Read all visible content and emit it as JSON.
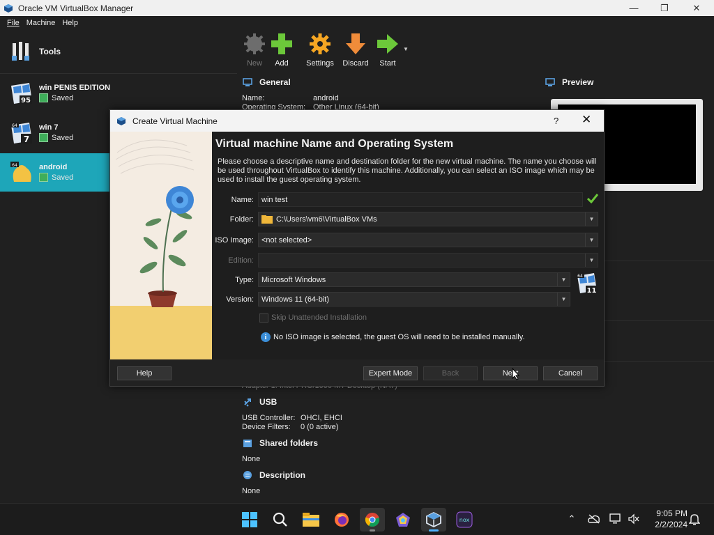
{
  "window": {
    "title": "Oracle VM VirtualBox Manager",
    "minimize": "—",
    "maximize": "❐",
    "close": "✕"
  },
  "menu": [
    {
      "label": "File"
    },
    {
      "label": "Machine"
    },
    {
      "label": "Help"
    }
  ],
  "left_panel": {
    "tools_label": "Tools",
    "vms": [
      {
        "name": "win PENIS EDITION",
        "state": "Saved",
        "badge": "95"
      },
      {
        "name": "win 7",
        "state": "Saved",
        "badge": "7"
      },
      {
        "name": "android",
        "state": "Saved",
        "badge": "64"
      }
    ]
  },
  "toolbar": {
    "new": "New",
    "add": "Add",
    "settings": "Settings",
    "discard": "Discard",
    "start": "Start"
  },
  "details": {
    "general_title": "General",
    "name_key": "Name:",
    "name_value": "android",
    "os_key": "Operating System:",
    "os_value": "Other Linux (64-bit)",
    "preview_title": "Preview",
    "network_partial": "Adapter 1:   Intel PRO/1000 MT Desktop (NAT)",
    "usb_title": "USB",
    "usb_controller_key": "USB Controller:",
    "usb_controller_value": "OHCI, EHCI",
    "device_filters_key": "Device Filters:",
    "device_filters_value": "0 (0 active)",
    "shared_title": "Shared folders",
    "shared_value": "None",
    "description_title": "Description",
    "description_value": "None"
  },
  "dialog": {
    "title": "Create Virtual Machine",
    "help_glyph": "?",
    "close_glyph": "✕",
    "heading": "Virtual machine Name and Operating System",
    "description": "Please choose a descriptive name and destination folder for the new virtual machine. The name you choose will be used throughout VirtualBox to identify this machine. Additionally, you can select an ISO image which may be used to install the guest operating system.",
    "name_label": "Name:",
    "name_value": "win test",
    "folder_label": "Folder:",
    "folder_value": "C:\\Users\\vm6\\VirtualBox VMs",
    "iso_label": "ISO Image:",
    "iso_value": "<not selected>",
    "edition_label": "Edition:",
    "edition_value": "",
    "type_label": "Type:",
    "type_value": "Microsoft Windows",
    "version_label": "Version:",
    "version_value": "Windows 11 (64-bit)",
    "os_badge": "11",
    "skip_label": "Skip Unattended Installation",
    "info_text": "No ISO image is selected, the guest OS will need to be installed manually.",
    "buttons": {
      "help": "Help",
      "expert": "Expert Mode",
      "back": "Back",
      "next": "Next",
      "cancel": "Cancel"
    }
  },
  "taskbar": {
    "apps": [
      "start-icon",
      "search-icon",
      "file-explorer-icon",
      "firefox-icon",
      "chrome-icon",
      "app-icon",
      "virtualbox-icon",
      "nox-icon"
    ],
    "nox_label": "nox",
    "time": "9:05 PM",
    "date": "2/2/2024"
  },
  "colors": {
    "selected_vm": "#1ea6b9",
    "add_green": "#6cc83a",
    "settings_orange": "#f5a623",
    "discard_orange": "#f08c3a",
    "start_green": "#6cc83a"
  }
}
